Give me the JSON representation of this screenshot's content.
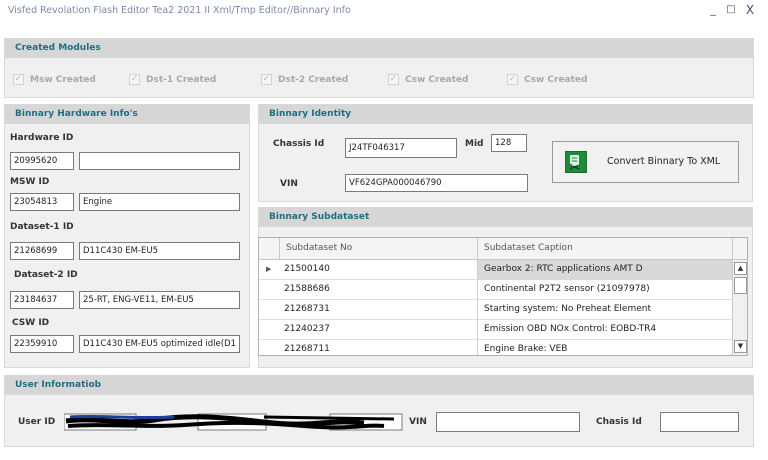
{
  "window": {
    "title": "Visfed Revolation Flash Editor Tea2 2021 II Xml/Tmp Editor//Binnary  Info",
    "minimize": "_",
    "maximize": "□",
    "close": "X"
  },
  "created_modules": {
    "header": "Created Modules",
    "items": [
      {
        "label": "Msw Created",
        "checked": true
      },
      {
        "label": "Dst-1 Created",
        "checked": true
      },
      {
        "label": "Dst-2 Created",
        "checked": true
      },
      {
        "label": "Csw Created",
        "checked": true
      },
      {
        "label": "Csw Created",
        "checked": true
      }
    ]
  },
  "hardware_info": {
    "header": "Binnary Hardware Info's",
    "hardware_id": {
      "label": "Hardware ID",
      "code": "20995620",
      "desc": ""
    },
    "msw_id": {
      "label": "MSW ID",
      "code": "23054813",
      "desc": "Engine"
    },
    "dataset1_id": {
      "label": "Dataset-1 ID",
      "code": "21268699",
      "desc": "D11C430 EM-EU5"
    },
    "dataset2_id": {
      "label": "Dataset-2 ID",
      "code": "23184637",
      "desc": "25-RT, ENG-VE11, EM-EU5"
    },
    "csw_id": {
      "label": "CSW ID",
      "code": "22359910",
      "desc": "D11C430 EM-EU5 optimized idle(D1"
    }
  },
  "identity": {
    "header": "Binnary Identity",
    "chassis_label": "Chassis Id",
    "chassis_value": "J24TF046317",
    "mid_label": "Mid",
    "mid_value": "128",
    "vin_label": "VIN",
    "vin_value": "VF624GPA000046790",
    "convert_button": "Convert Binnary To XML",
    "convert_icon": "xml-scissors-icon"
  },
  "subdataset": {
    "header": "Binnary Subdataset",
    "columns": [
      "Subdataset No",
      "Subdataset Caption"
    ],
    "rows": [
      {
        "no": "21500140",
        "caption": "Gearbox 2: RTC applications AMT D",
        "selected": true
      },
      {
        "no": "21588686",
        "caption": "Continental P2T2 sensor (21097978)"
      },
      {
        "no": "21268731",
        "caption": "Starting system: No Preheat Element"
      },
      {
        "no": "21240237",
        "caption": "Emission OBD NOx Control: EOBD-TR4"
      },
      {
        "no": "21268711",
        "caption": "Engine Brake: VEB"
      }
    ]
  },
  "user_info": {
    "header": "User Informatiob",
    "user_id_label": "User ID",
    "vin_label": "VIN",
    "vin_value": "",
    "chasis_label": "Chasis Id",
    "chasis_value": ""
  }
}
